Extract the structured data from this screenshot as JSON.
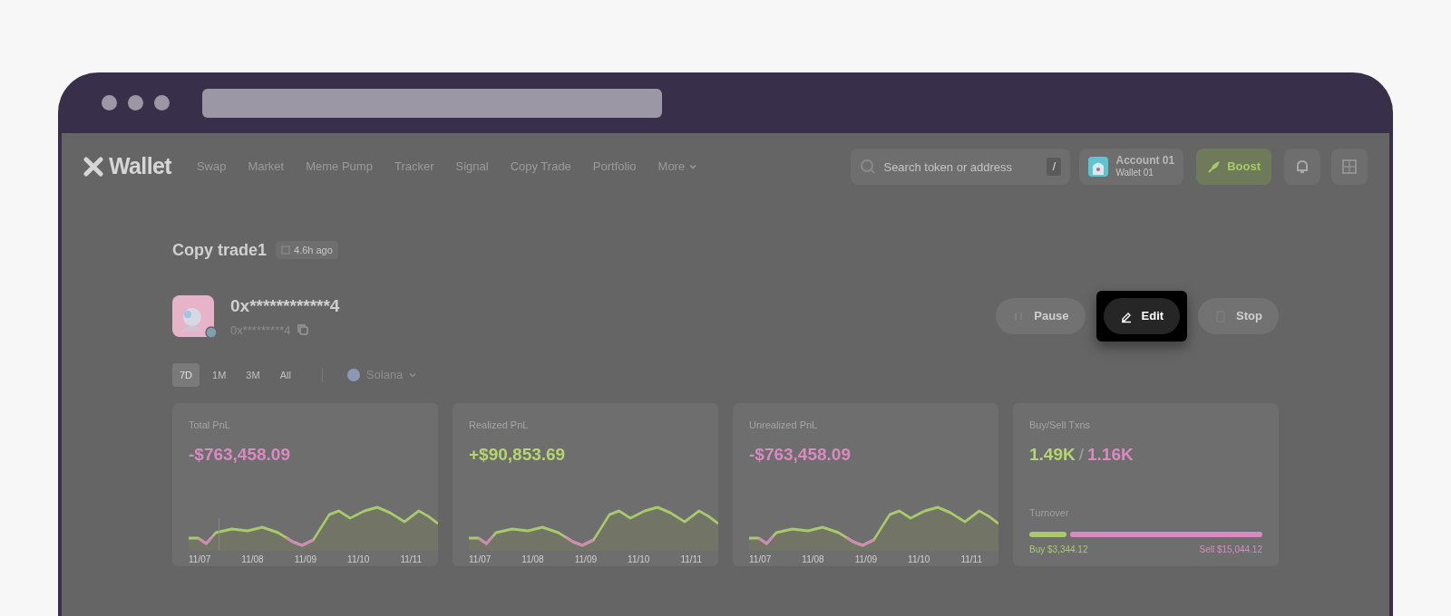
{
  "brand": {
    "name": "Wallet"
  },
  "nav": [
    {
      "label": "Swap"
    },
    {
      "label": "Market"
    },
    {
      "label": "Meme Pump"
    },
    {
      "label": "Tracker"
    },
    {
      "label": "Signal"
    },
    {
      "label": "Copy Trade"
    },
    {
      "label": "Portfolio"
    },
    {
      "label": "More",
      "dropdown": true
    }
  ],
  "search": {
    "placeholder": "Search token or address",
    "shortcut": "/"
  },
  "account": {
    "name": "Account 01",
    "wallet": "Wallet 01"
  },
  "boost": {
    "label": "Boost"
  },
  "page": {
    "title": "Copy trade1",
    "age": "4.6h ago"
  },
  "trader": {
    "address": "0x************4",
    "sub_address": "0x*********4"
  },
  "actions": [
    {
      "kind": "pause",
      "label": "Pause",
      "highlighted": false
    },
    {
      "kind": "edit",
      "label": "Edit",
      "highlighted": true
    },
    {
      "kind": "stop",
      "label": "Stop",
      "highlighted": false
    }
  ],
  "periods": [
    {
      "label": "7D",
      "selected": true
    },
    {
      "label": "1M",
      "selected": false
    },
    {
      "label": "3M",
      "selected": false
    },
    {
      "label": "All",
      "selected": false
    }
  ],
  "chain": {
    "label": "Solana"
  },
  "cards": [
    {
      "kind": "chart",
      "title": "Total PnL",
      "value": "-$763,458.09",
      "color": "#d98ac0",
      "x_labels": [
        "11/07",
        "11/08",
        "11/09",
        "11/10",
        "11/11"
      ],
      "cursor": true
    },
    {
      "kind": "chart",
      "title": "Realized PnL",
      "value": "+$90,853.69",
      "color": "#b5d66e",
      "x_labels": [
        "11/07",
        "11/08",
        "11/09",
        "11/10",
        "11/11"
      ]
    },
    {
      "kind": "chart",
      "title": "Unrealized PnL",
      "value": "-$763,458.09",
      "color": "#d98ac0",
      "x_labels": [
        "11/07",
        "11/08",
        "11/09",
        "11/10",
        "11/11"
      ]
    },
    {
      "kind": "txns",
      "title": "Buy/Sell Txns",
      "buys": "1.49K",
      "separator": "/",
      "sells": "1.16K",
      "turnover_label": "Turnover",
      "level": 0.16,
      "buy_amount": "Buy $3,344.12",
      "sell_amount": "Sell $15,044.12"
    }
  ]
}
